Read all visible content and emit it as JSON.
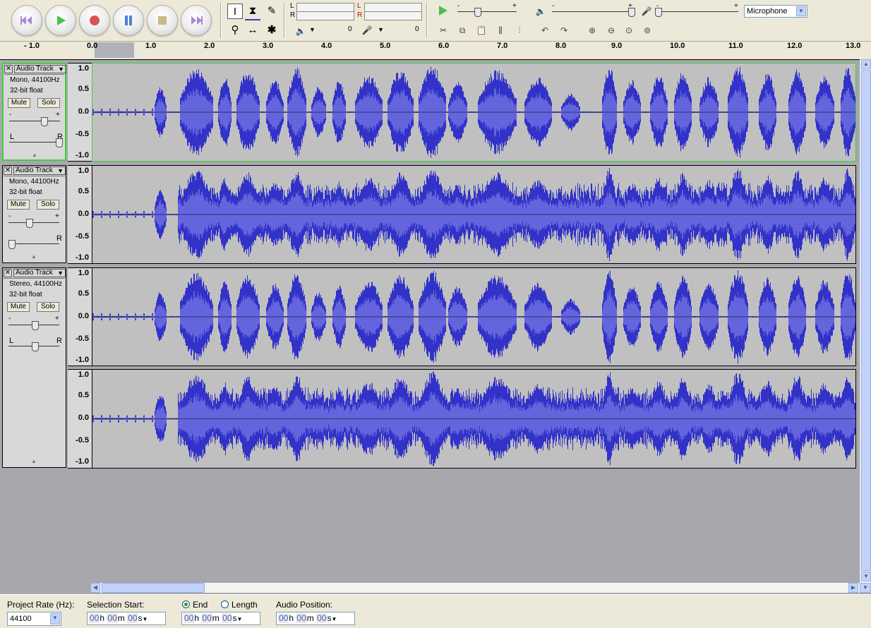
{
  "toolbar": {
    "transport": [
      "skip-start",
      "play",
      "record",
      "pause",
      "stop",
      "skip-end"
    ],
    "meter_left": "L",
    "meter_right": "R",
    "meter_left2": "L",
    "meter_right2": "R",
    "play_volume_value": "0",
    "record_volume_value": "0",
    "input_source": "Microphone",
    "slider_minus": "-",
    "slider_plus": "+"
  },
  "ruler": {
    "ticks": [
      "- 1.0",
      "0.0",
      "1.0",
      "2.0",
      "3.0",
      "4.0",
      "5.0",
      "6.0",
      "7.0",
      "8.0",
      "9.0",
      "10.0",
      "11.0",
      "12.0",
      "13.0"
    ]
  },
  "tracks": [
    {
      "name": "Audio Track",
      "format": "Mono, 44100Hz",
      "sample": "32-bit float",
      "mute": "Mute",
      "solo": "Solo",
      "gain_minus": "-",
      "gain_plus": "+",
      "pan_left": "L",
      "pan_right": "R",
      "gain_level": 0.68,
      "pan_level": 1.0,
      "scale": [
        "1.0",
        "0.5",
        "0.0",
        "-0.5",
        "-1.0"
      ]
    },
    {
      "name": "Audio Track",
      "format": "Mono, 44100Hz",
      "sample": "32-bit float",
      "mute": "Mute",
      "solo": "Solo",
      "gain_minus": "-",
      "gain_plus": "+",
      "pan_left": "L",
      "pan_right": "R",
      "gain_level": 0.38,
      "pan_level": 0.0,
      "scale": [
        "1.0",
        "0.5",
        "0.0",
        "-0.5",
        "-1.0"
      ]
    },
    {
      "name": "Audio Track",
      "format": "Stereo, 44100Hz",
      "sample": "32-bit float",
      "mute": "Mute",
      "solo": "Solo",
      "gain_minus": "-",
      "gain_plus": "+",
      "pan_left": "L",
      "pan_right": "R",
      "gain_level": 0.5,
      "pan_level": 0.5,
      "scale": [
        "1.0",
        "0.5",
        "0.0",
        "-0.5",
        "-1.0"
      ],
      "scale2": [
        "1.0",
        "0.5",
        "0.0",
        "-0.5",
        "-1.0"
      ]
    }
  ],
  "status": {
    "project_rate_label": "Project Rate (Hz):",
    "project_rate": "44100",
    "selection_start_label": "Selection Start:",
    "end_label": "End",
    "length_label": "Length",
    "audio_position_label": "Audio Position:",
    "time_h": "00",
    "time_m": "00",
    "time_s": "00",
    "unit_h": "h",
    "unit_m": "m",
    "unit_s": "s"
  },
  "colors": {
    "wave_dark": "#3232c8",
    "wave_light": "#6464dc",
    "wave_bg": "#c0c0c0",
    "selected_border": "#3bd33b"
  }
}
